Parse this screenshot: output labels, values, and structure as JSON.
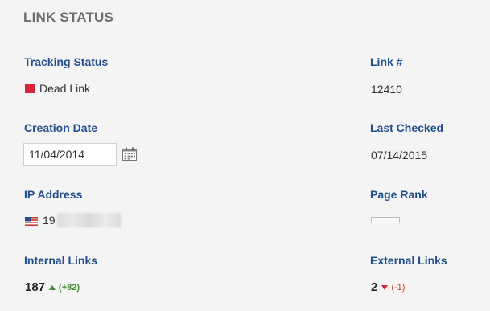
{
  "panel": {
    "title": "LINK STATUS"
  },
  "tracking_status": {
    "label": "Tracking Status",
    "value": "Dead Link",
    "color": "#d9263a"
  },
  "link_number": {
    "label": "Link #",
    "value": "12410"
  },
  "creation_date": {
    "label": "Creation Date",
    "value": "11/04/2014"
  },
  "last_checked": {
    "label": "Last Checked",
    "value": "07/14/2015"
  },
  "ip_address": {
    "label": "IP Address",
    "value_prefix": "19",
    "flag_icon": "us-flag-icon"
  },
  "page_rank": {
    "label": "Page Rank",
    "level": 0
  },
  "internal_links": {
    "label": "Internal Links",
    "count": "187",
    "delta": "(+82)",
    "direction": "up"
  },
  "external_links": {
    "label": "External Links",
    "count": "2",
    "delta": "(-1)",
    "direction": "down"
  }
}
